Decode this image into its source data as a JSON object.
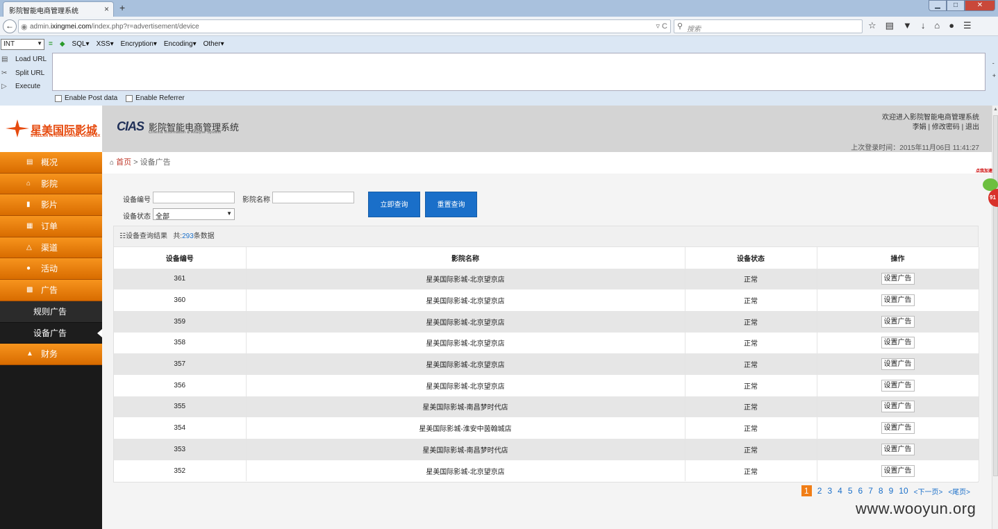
{
  "browser": {
    "tab_title": "影院智能电商管理系统",
    "tab_close": "×",
    "new_tab": "+",
    "window_min": "▁",
    "window_max": "□",
    "window_close": "✕",
    "url_prefix": "admin.",
    "url_domain": "ixingmei.com",
    "url_path": "/index.php?r=advertisement/device",
    "url_controls": "▿  C",
    "search_placeholder": "搜索",
    "toolbar_icons": [
      "star-icon",
      "bookmarks-icon",
      "pocket-icon",
      "download-icon",
      "home-icon",
      "chat-icon",
      "menu-icon"
    ]
  },
  "hackbar": {
    "select_value": "INT",
    "menu": [
      "SQL▾",
      "XSS▾",
      "Encryption▾",
      "Encoding▾",
      "Other▾"
    ],
    "load_url": "Load URL",
    "split_url": "Split URL",
    "execute": "Execute",
    "enable_post": "Enable Post data",
    "enable_referrer": "Enable Referrer"
  },
  "header": {
    "logo_cn": "星美国际影城",
    "logo_en": "STELLAR INTERNATIONAL CINEPLEX",
    "cias": "CIAS",
    "system_name": "影院智能电商管理系统",
    "system_en": "Cinema Information & Analyse System",
    "welcome": "欢迎进入影院智能电商管理系统",
    "user_links": "李娟 | 修改密码 | 退出",
    "last_login": "上次登录时间：2015年11月06日 11:41:27"
  },
  "sidebar": {
    "items": [
      {
        "label": "概况",
        "icon": "chart-icon"
      },
      {
        "label": "影院",
        "icon": "home-icon"
      },
      {
        "label": "影片",
        "icon": "film-icon"
      },
      {
        "label": "订单",
        "icon": "order-icon"
      },
      {
        "label": "渠道",
        "icon": "channel-icon"
      },
      {
        "label": "活动",
        "icon": "activity-icon"
      },
      {
        "label": "广告",
        "icon": "ad-icon"
      }
    ],
    "sub_items": [
      "规则广告",
      "设备广告"
    ],
    "finance": "财务"
  },
  "breadcrumb": {
    "home": "首页",
    "separator": ">",
    "current": "设备广告"
  },
  "filters": {
    "device_no_label": "设备编号",
    "cinema_name_label": "影院名称",
    "status_label": "设备状态",
    "status_value": "全部",
    "query_button": "立即查询",
    "reset_button": "重置查询"
  },
  "results": {
    "title": "设备查询结果",
    "count_prefix": "共:",
    "count": "293",
    "count_suffix": "条数据",
    "columns": [
      "设备编号",
      "影院名称",
      "设备状态",
      "操作"
    ],
    "action_label": "设置广告",
    "rows": [
      {
        "id": "361",
        "cinema": "星美国际影城-北京望京店",
        "status": "正常"
      },
      {
        "id": "360",
        "cinema": "星美国际影城-北京望京店",
        "status": "正常"
      },
      {
        "id": "359",
        "cinema": "星美国际影城-北京望京店",
        "status": "正常"
      },
      {
        "id": "358",
        "cinema": "星美国际影城-北京望京店",
        "status": "正常"
      },
      {
        "id": "357",
        "cinema": "星美国际影城-北京望京店",
        "status": "正常"
      },
      {
        "id": "356",
        "cinema": "星美国际影城-北京望京店",
        "status": "正常"
      },
      {
        "id": "355",
        "cinema": "星美国际影城-南昌梦时代店",
        "status": "正常"
      },
      {
        "id": "354",
        "cinema": "星美国际影城-淮安中茵翰城店",
        "status": "正常"
      },
      {
        "id": "353",
        "cinema": "星美国际影城-南昌梦时代店",
        "status": "正常"
      },
      {
        "id": "352",
        "cinema": "星美国际影城-北京望京店",
        "status": "正常"
      }
    ]
  },
  "pager": {
    "current": "1",
    "pages": [
      "2",
      "3",
      "4",
      "5",
      "6",
      "7",
      "8",
      "9",
      "10"
    ],
    "next": "<下一页>",
    "last": "<尾页>"
  },
  "float_badge": {
    "text": "点我加速",
    "value": "91"
  },
  "watermark": "www.wooyun.org",
  "colors": {
    "accent_orange": "#f7941d",
    "button_blue": "#1a6fc9",
    "status_green": "#2aa52a",
    "header_gray": "#d4d4d4"
  }
}
